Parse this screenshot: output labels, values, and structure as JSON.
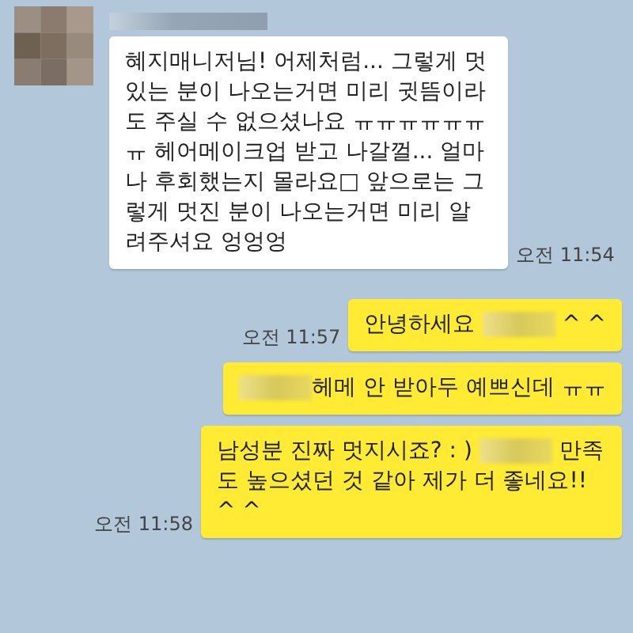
{
  "sender": {
    "name_redacted": true
  },
  "messages": [
    {
      "kind": "incoming",
      "time": "오전 11:54",
      "parts": [
        {
          "kind": "text",
          "text": "혜지매니저님! 어제처럼... 그렇게 멋있는 분이 나오는거면 미리 귓뜸이라도 주실 수 없으셨나요 ㅠㅠㅠㅠㅠㅠㅠ 헤어메이크업 받고 나갈껄... 얼마나 후회했는지 몰라요□ 앞으로는 그렇게 멋진 분이 나오는거면 미리 알려주셔요 엉엉엉"
        }
      ]
    },
    {
      "kind": "outgoing",
      "time": "오전 11:57",
      "parts": [
        {
          "kind": "text",
          "text": "안녕하세요 "
        },
        {
          "kind": "redacted"
        },
        {
          "kind": "text",
          "text": " ^ ^"
        }
      ]
    },
    {
      "kind": "outgoing",
      "parts": [
        {
          "kind": "redacted"
        },
        {
          "kind": "text",
          "text": "헤메 안 받아두 예쁘신데 ㅠㅠ"
        }
      ]
    },
    {
      "kind": "outgoing",
      "time": "오전 11:58",
      "parts": [
        {
          "kind": "text",
          "text": "남성분 진짜 멋지시죠? : ) "
        },
        {
          "kind": "redacted"
        },
        {
          "kind": "text",
          "text": " 만족도 높으셨던 것 같아 제가 더 좋네요!! ^ ^"
        }
      ]
    }
  ]
}
